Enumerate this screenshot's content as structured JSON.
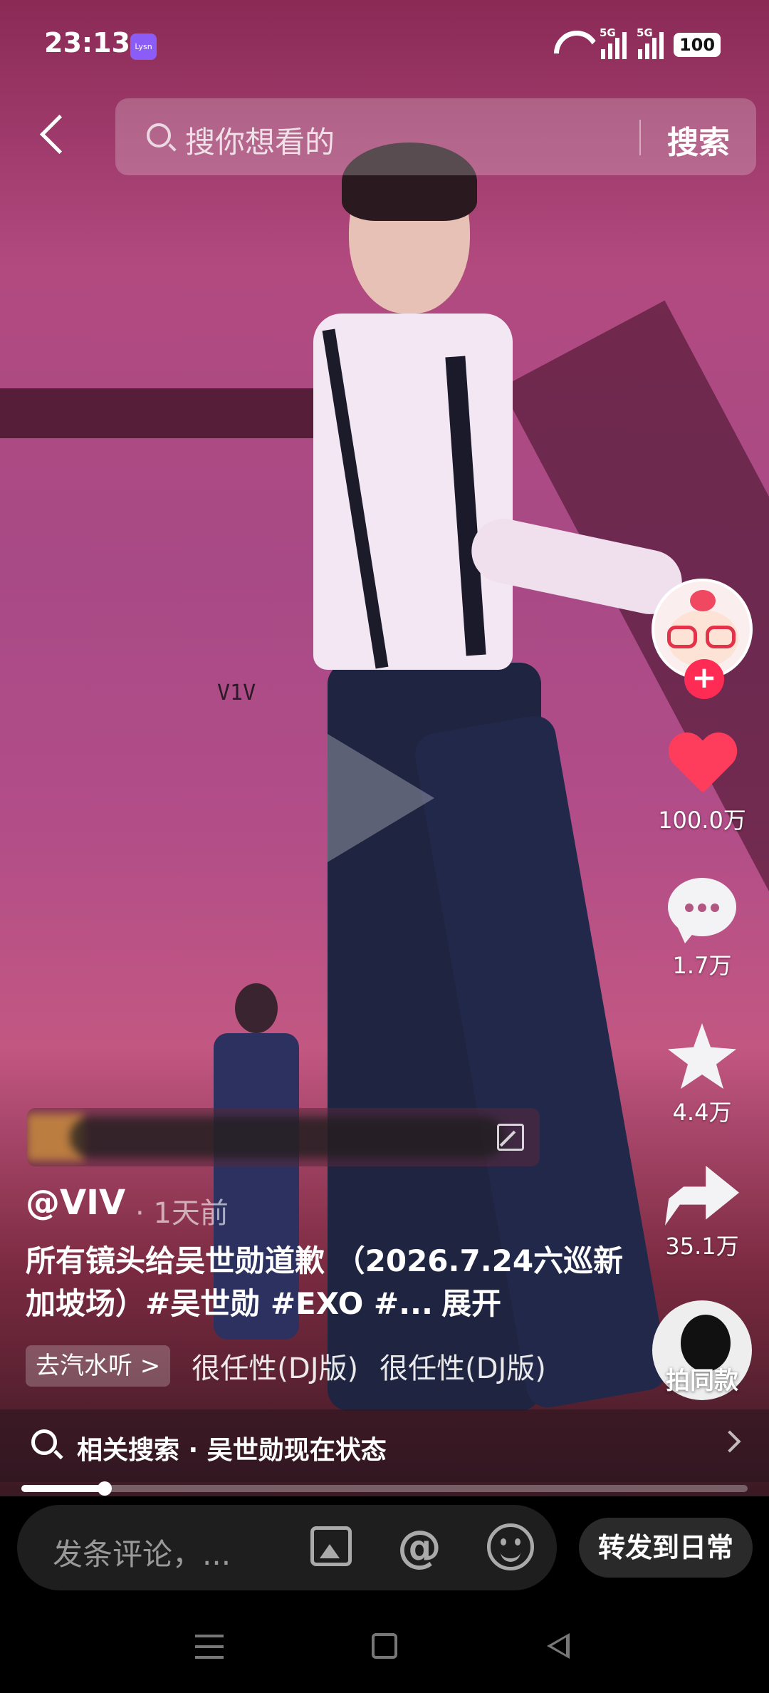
{
  "status_bar": {
    "time": "23:13",
    "app_badge": "Lysn",
    "network_1": "5G",
    "network_2": "5G",
    "battery": "100"
  },
  "search": {
    "placeholder": "搜你想看的",
    "button_label": "搜索"
  },
  "video": {
    "watermark": "V1V",
    "progress": 0.115
  },
  "actions": {
    "likes": "100.0万",
    "comments": "1.7万",
    "favorites": "4.4万",
    "shares": "35.1万",
    "same_style_label": "拍同款"
  },
  "post": {
    "author": "@VIV",
    "time": "· 1天前",
    "caption": "所有镜头给吴世勋道歉 （2026.7.24六巡新加坡场）#吴世勋 #EXO #...",
    "expand_label": "展开"
  },
  "music": {
    "chip_label": "去汽水听 >",
    "titles": [
      "很任性(DJ版)",
      "很任性(DJ版)"
    ]
  },
  "related": {
    "text": "相关搜索 · 吴世勋现在状态"
  },
  "bottom_bar": {
    "comment_placeholder": "发条评论，...",
    "at_symbol": "@",
    "forward_label": "转发到日常"
  },
  "colors": {
    "like": "#fe3d5c",
    "follow": "#fe2c55"
  }
}
